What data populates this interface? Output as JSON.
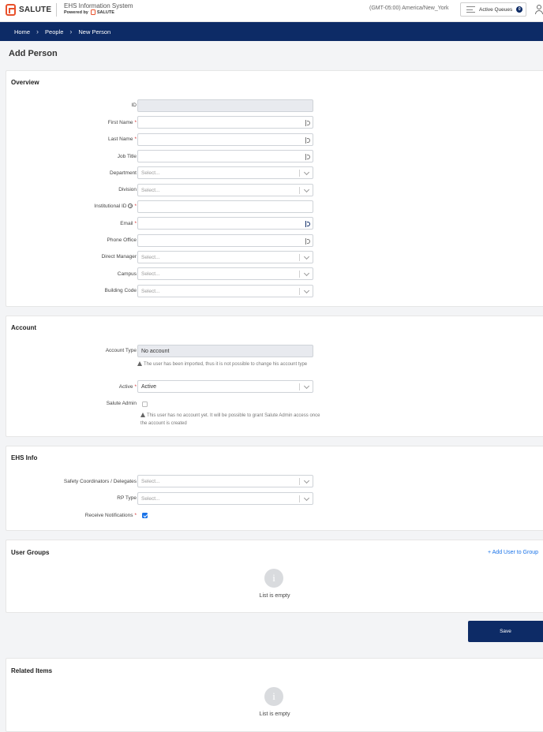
{
  "header": {
    "brand": "SALUTE",
    "app_title": "EHS Information System",
    "powered_by": "Powered by",
    "powered_brand": "SALUTE",
    "timezone": "(GMT-05:00) America/New_York",
    "active_queues_label": "Active Queues",
    "active_queues_count": "0"
  },
  "breadcrumb": [
    "Home",
    "People",
    "New Person"
  ],
  "page_title": "Add Person",
  "overview": {
    "title": "Overview",
    "fields": {
      "id": {
        "label": "ID",
        "value": ""
      },
      "first_name": {
        "label": "First Name",
        "required": "*",
        "value": ""
      },
      "last_name": {
        "label": "Last Name",
        "required": "*",
        "value": ""
      },
      "job_title": {
        "label": "Job Title",
        "value": ""
      },
      "department": {
        "label": "Department",
        "placeholder": "Select..."
      },
      "division": {
        "label": "Division",
        "placeholder": "Select..."
      },
      "institutional_id": {
        "label": "Institutional ID",
        "help": "?",
        "required": "*",
        "value": ""
      },
      "email": {
        "label": "Email",
        "required": "*",
        "value": ""
      },
      "phone_office": {
        "label": "Phone Office",
        "value": ""
      },
      "direct_manager": {
        "label": "Direct Manager",
        "placeholder": "Select..."
      },
      "campus": {
        "label": "Campus",
        "placeholder": "Select..."
      },
      "building_code": {
        "label": "Building Code",
        "placeholder": "Select..."
      }
    }
  },
  "account": {
    "title": "Account",
    "account_type": {
      "label": "Account Type",
      "value": "No account"
    },
    "account_type_note": "The user has been imported, thus it is not possible to change his account type",
    "active": {
      "label": "Active",
      "required": "*",
      "value": "Active"
    },
    "salute_admin": {
      "label": "Salute Admin",
      "checked": false
    },
    "salute_admin_note": "This user has no account yet. It will be possible to grant Salute Admin access once the account is created"
  },
  "ehs_info": {
    "title": "EHS Info",
    "safety_coordinators": {
      "label": "Safety Coordinators / Delegates",
      "placeholder": "Select..."
    },
    "rp_type": {
      "label": "RP Type",
      "placeholder": "Select..."
    },
    "receive_notifications": {
      "label": "Receive Notifications",
      "required": "*",
      "checked": true
    }
  },
  "user_groups": {
    "title": "User Groups",
    "add_link": "+ Add User to Group",
    "empty_icon": "i",
    "empty_text": "List is empty"
  },
  "save_label": "Save",
  "related_items": {
    "title": "Related Items",
    "empty_icon": "i",
    "empty_text": "List is empty"
  },
  "icons": {
    "brand_color": "#e8512c",
    "nav_color": "#0d2b66",
    "link_color": "#1a73e8"
  }
}
